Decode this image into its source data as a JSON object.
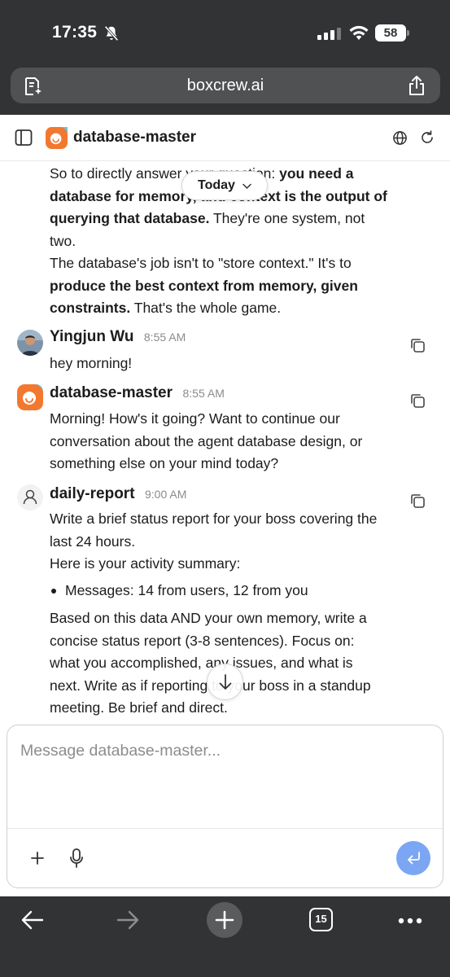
{
  "status_bar": {
    "time": "17:35",
    "battery": "58",
    "icons": [
      "bell-off-icon",
      "signal-icon",
      "wifi-icon",
      "battery-icon"
    ]
  },
  "browser": {
    "url": "boxcrew.ai",
    "tab_count": "15",
    "icons": [
      "page-tools-icon",
      "share-icon",
      "back-arrow-icon",
      "forward-arrow-icon",
      "plus-icon",
      "more-icon"
    ]
  },
  "header": {
    "title": "database-master",
    "icons": [
      "sidebar-icon",
      "globe-icon",
      "refresh-icon"
    ]
  },
  "date_pill": {
    "label": "Today"
  },
  "messages": [
    {
      "lines": [
        [
          {
            "t": "So to directly answer your question: "
          },
          {
            "t": "you need a",
            "b": true
          }
        ],
        [
          {
            "t": "database for memory, and context is the output of",
            "b": true
          }
        ],
        [
          {
            "t": "querying that database.",
            "b": true
          },
          {
            "t": " They're one system, not"
          }
        ],
        [
          {
            "t": "two."
          }
        ],
        [
          {
            "t": "The database's job isn't to \"store context.\" It's to"
          }
        ],
        [
          {
            "t": "produce the best context from memory, given",
            "b": true
          }
        ],
        [
          {
            "t": "constraints.",
            "b": true
          },
          {
            "t": " That's the whole game."
          }
        ]
      ]
    },
    {
      "author": "Yingjun Wu",
      "time": "8:55 AM",
      "lines": [
        [
          {
            "t": "hey morning!"
          }
        ]
      ]
    },
    {
      "author": "database-master",
      "time": "8:55 AM",
      "lines": [
        [
          {
            "t": "Morning! How's it going? Want to continue our"
          }
        ],
        [
          {
            "t": "conversation about the agent database design, or"
          }
        ],
        [
          {
            "t": "something else on your mind today?"
          }
        ]
      ]
    },
    {
      "author": "daily-report",
      "time": "9:00 AM",
      "lines": [
        [
          {
            "t": "Write a brief status report for your boss covering the"
          }
        ],
        [
          {
            "t": "last 24 hours."
          }
        ],
        [
          {
            "t": "Here is your activity summary:"
          }
        ]
      ],
      "bullets": [
        "Messages: 14 from users, 12 from you"
      ],
      "lines_after": [
        [
          {
            "t": "Based on this data AND your own memory, write a"
          }
        ],
        [
          {
            "t": "concise status report (3-8 sentences). Focus on:"
          }
        ],
        [
          {
            "t": "what you accomplished, any issues, and what is"
          }
        ],
        [
          {
            "t": "next. Write as if reporting to your boss in a standup"
          }
        ],
        [
          {
            "t": "meeting. Be brief and direct."
          }
        ]
      ]
    }
  ],
  "composer": {
    "placeholder": "Message database-master..."
  },
  "colors": {
    "chrome": "#323334",
    "url_bar": "#505152",
    "send_button": "#7aa6f4",
    "avatar_orange": "#f3782f",
    "avatar_blue": "#6fc1d9"
  }
}
